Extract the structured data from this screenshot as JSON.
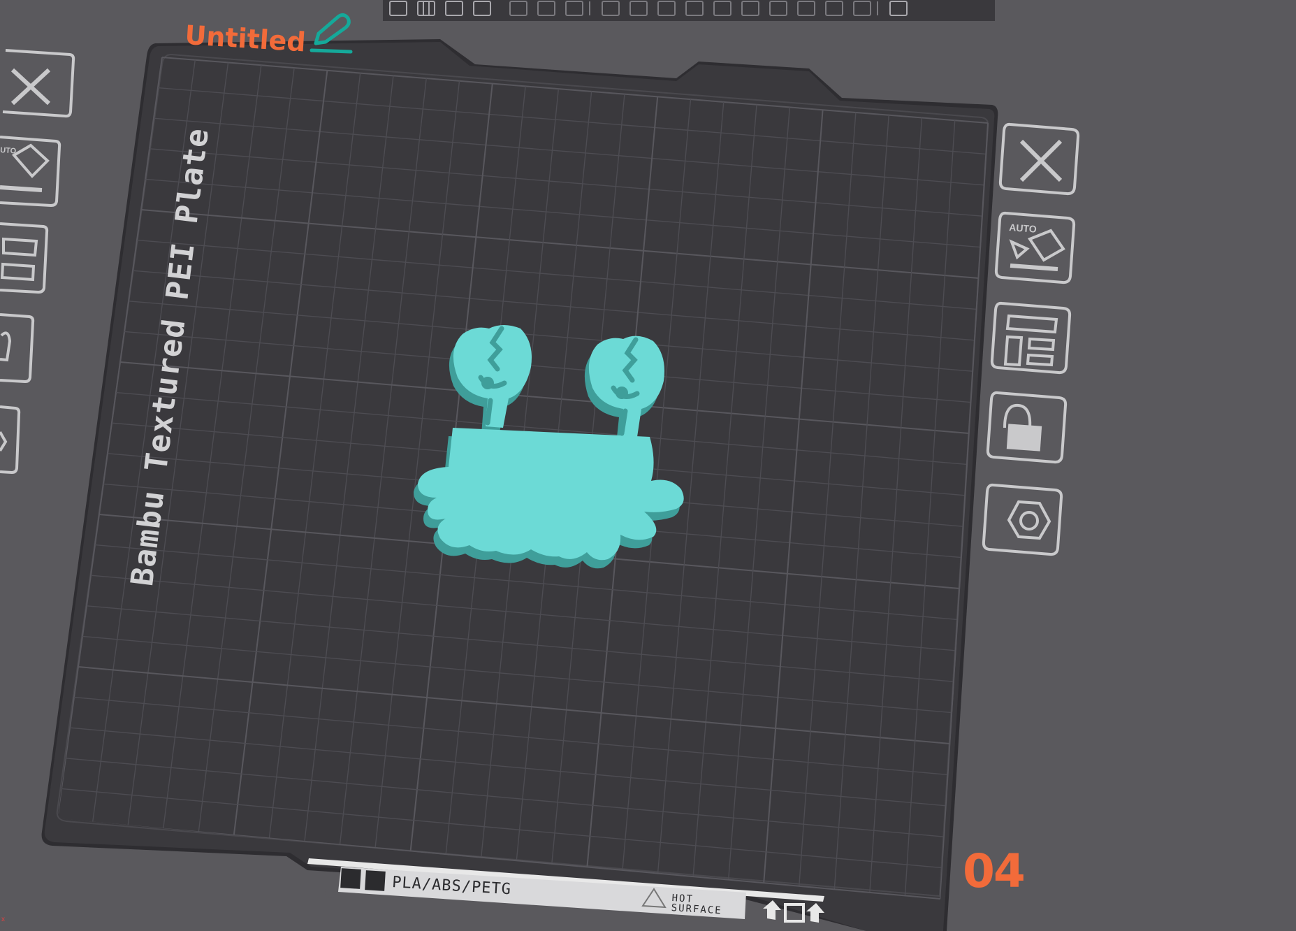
{
  "project": {
    "title": "Untitled",
    "edit_icon": "pencil-edit-icon"
  },
  "plate": {
    "type_label": "Bambu Textured PEI Plate",
    "number": "04",
    "strip_text": "PLA/ABS/PETG",
    "hot_surface": [
      "HOT",
      "SURFACE"
    ],
    "strip_icons": [
      "grid-logo-icon",
      "arrows-plate-icon"
    ]
  },
  "object": {
    "name": "crab-model",
    "color": "#6cdad6"
  },
  "toolbar": {
    "buttons": [
      "add-plate-icon",
      "orient-grid-icon",
      "auto-orient-icon",
      "arrange-icon",
      "split-objects-icon",
      "split-parts-icon",
      "layers-icon",
      "move-icon",
      "rotate-icon",
      "scale-icon",
      "lay-on-face-icon",
      "cut-icon",
      "mesh-boolean-icon",
      "support-paint-icon",
      "seam-paint-icon",
      "text-icon",
      "measure-icon",
      "assembly-icon"
    ]
  },
  "plate_toolbar": {
    "auto_label": "AUTO",
    "buttons": [
      "remove-plate",
      "auto-arrange-plate",
      "plate-layout",
      "lock-plate",
      "plate-settings"
    ]
  },
  "colors": {
    "accent": "#f26b3a",
    "edit_accent": "#15a99a",
    "plate": "#3a393d",
    "background": "#5a595d",
    "icon_stroke": "#c9c9cb",
    "model": "#6cdad6"
  }
}
